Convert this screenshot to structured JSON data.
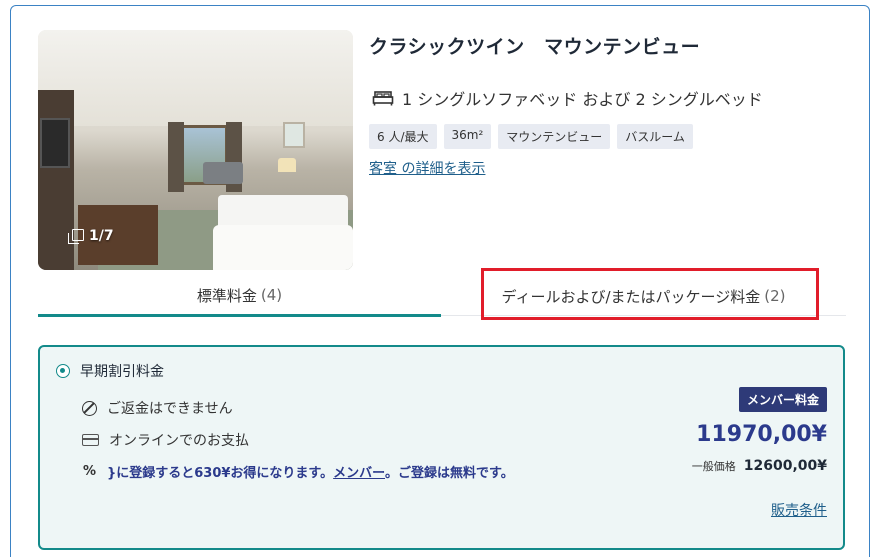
{
  "room": {
    "title": "クラシックツイン　マウンテンビュー",
    "beds": "1 シングルソファベッド および 2 シングルベッド",
    "photo_count": "1/7",
    "tags": [
      "6 人/最大",
      "36m²",
      "マウンテンビュー",
      "バスルーム"
    ],
    "details_link": "客室 の詳細を表示"
  },
  "tabs": [
    {
      "label": "標準料金",
      "count": "(4)",
      "active": true
    },
    {
      "label": "ディールおよび/またはパッケージ料金",
      "count": "(2)",
      "active": false
    }
  ],
  "rate": {
    "name": "早期割引料金",
    "features": {
      "refund": "ご返金はできません",
      "payment": "オンラインでのお支払"
    },
    "member_msg_pre": "}に登録すると630¥お得になります。",
    "member_link": "メンバー",
    "member_msg_post": "。ご登録は無料です。",
    "member_badge": "メンバー料金",
    "member_price": "11970,00¥",
    "general_label": "一般価格",
    "general_price": "12600,00¥",
    "terms_link": "販売条件"
  },
  "colors": {
    "accent": "#138a8a",
    "member": "#2b3a8c",
    "highlight": "#e11d2a"
  }
}
